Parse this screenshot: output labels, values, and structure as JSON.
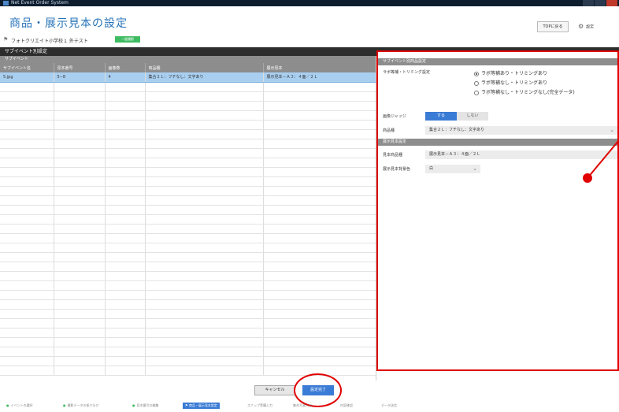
{
  "window": {
    "title": "Net Event Order System"
  },
  "header": {
    "title": "商品・展示見本の設定",
    "top_button": "TOPに戻る",
    "settings_button": "設定"
  },
  "event": {
    "name": "フォトクリエイト小学校１ 外テスト",
    "badge": "一般撮影"
  },
  "section": {
    "title": "サブイベント別設定"
  },
  "left": {
    "subheader": "サブイベント",
    "columns": [
      "サブイベント名",
      "見本番号",
      "画像数",
      "商品種",
      "展示見本"
    ],
    "rows": [
      {
        "name": "5.jpg",
        "sample_no": "5−8",
        "count": "4",
        "product": "集合２Ｌ：フチなし：文字あり",
        "display": "展示見本－Ａ３：４面／２Ｌ",
        "selected": true
      }
    ]
  },
  "right": {
    "product_header": "サブイベント別商品設定",
    "trim_label": "ラボ等補・トリミング設定",
    "trim_options": [
      {
        "label": "ラボ等補あり・トリミングあり",
        "checked": true
      },
      {
        "label": "ラボ等補なし・トリミングあり",
        "checked": false
      },
      {
        "label": "ラボ等補なし・トリミングなし(完全データ)",
        "checked": false
      }
    ],
    "judge_label": "画像ジャッジ",
    "judge_on": "する",
    "judge_off": "しない",
    "product_label": "商品種",
    "product_value": "集合２Ｌ：フチなし：文字あり",
    "display_header": "展示見本設定",
    "sample_label": "見本商品種",
    "sample_value": "展示見本－Ａ３：４面／２Ｌ",
    "bg_label": "展示見本背景色",
    "bg_value": "白"
  },
  "footer": {
    "cancel": "キャンセル",
    "complete": "設定完了"
  },
  "steps": [
    "イベントの選択",
    "撮影データの振り分け",
    "見本番号の編集",
    "商品・展示見本設定",
    "スナップ等購入力",
    "集合写真入力",
    "内容確認",
    "データ送信"
  ],
  "colors": {
    "accent": "#3a7bd5",
    "annotation": "#e00000"
  }
}
